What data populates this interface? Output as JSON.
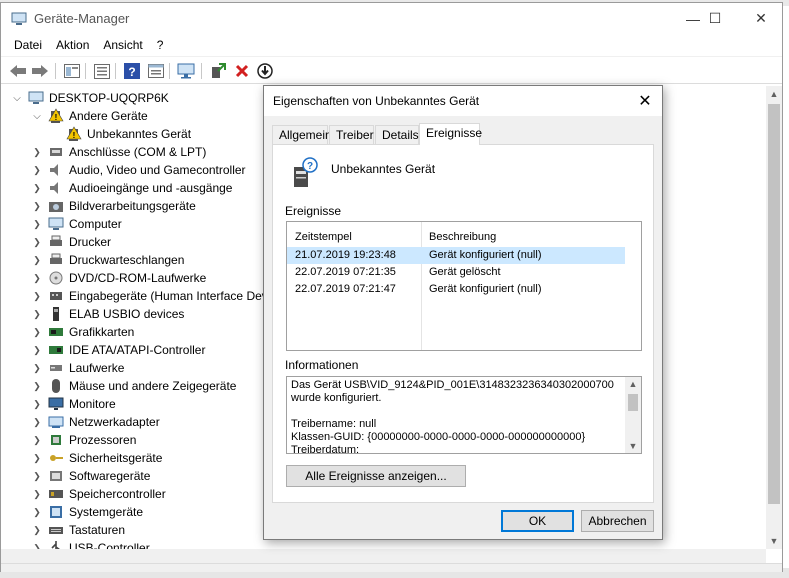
{
  "window": {
    "title": "Geräte-Manager",
    "controls": {
      "minimize": "—",
      "maximize": "☐",
      "close": "✕"
    }
  },
  "menu": [
    "Datei",
    "Aktion",
    "Ansicht",
    "?"
  ],
  "toolbar": {
    "icons": [
      "back-icon",
      "forward-icon",
      "properties-view-icon",
      "list-icon",
      "help-icon",
      "console-tree-icon",
      "scan-hardware-icon",
      "enable-device-icon",
      "uninstall-device-icon",
      "update-driver-icon"
    ],
    "colors": {
      "uninstall": "#d22020",
      "enable": "#2e8b2e"
    }
  },
  "tree": {
    "root": "DESKTOP-UQQRP6K",
    "other_devices": "Andere Geräte",
    "unknown_device": "Unbekanntes Gerät",
    "categories": [
      "Anschlüsse (COM & LPT)",
      "Audio, Video und Gamecontroller",
      "Audioeingänge und -ausgänge",
      "Bildverarbeitungsgeräte",
      "Computer",
      "Drucker",
      "Druckwarteschlangen",
      "DVD/CD-ROM-Laufwerke",
      "Eingabegeräte (Human Interface Devi",
      "ELAB USBIO devices",
      "Grafikkarten",
      "IDE ATA/ATAPI-Controller",
      "Laufwerke",
      "Mäuse und andere Zeigegeräte",
      "Monitore",
      "Netzwerkadapter",
      "Prozessoren",
      "Sicherheitsgeräte",
      "Softwaregeräte",
      "Speichercontroller",
      "Systemgeräte",
      "Tastaturen",
      "USB-Controller"
    ]
  },
  "dialog": {
    "title": "Eigenschaften von Unbekanntes Gerät",
    "close": "✕",
    "tabs": [
      "Allgemein",
      "Treiber",
      "Details",
      "Ereignisse"
    ],
    "active_tab": "Ereignisse",
    "device_name": "Unbekanntes Gerät",
    "events_label": "Ereignisse",
    "columns": [
      "Zeitstempel",
      "Beschreibung"
    ],
    "events": [
      {
        "time": "21.07.2019 19:23:48",
        "desc": "Gerät konfiguriert (null)"
      },
      {
        "time": "22.07.2019 07:21:35",
        "desc": "Gerät gelöscht"
      },
      {
        "time": "22.07.2019 07:21:47",
        "desc": "Gerät konfiguriert (null)"
      }
    ],
    "info_label": "Informationen",
    "info_lines": [
      "Das Gerät USB\\VID_9124&PID_001E\\3148323236340302000700",
      "wurde konfiguriert.",
      "",
      "Treibername: null",
      "Klassen-GUID: {00000000-0000-0000-0000-000000000000}",
      "Treiberdatum:"
    ],
    "all_events_button": "Alle Ereignisse anzeigen...",
    "ok_button": "OK",
    "cancel_button": "Abbrechen",
    "accent_color": "#0078d7",
    "selection_color": "#cce8ff"
  }
}
